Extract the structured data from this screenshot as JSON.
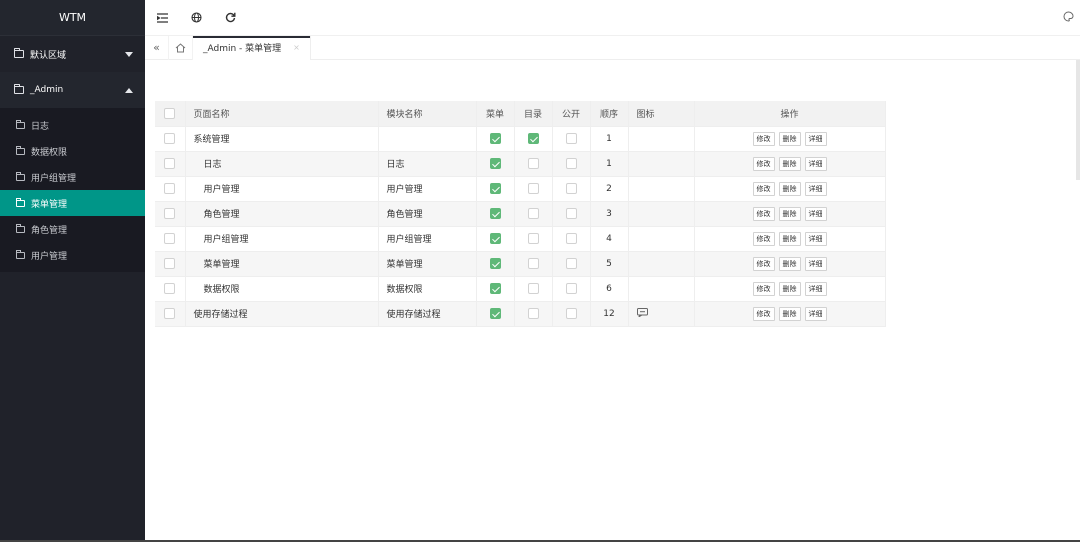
{
  "app": {
    "title": "WTM"
  },
  "sidebar": {
    "areas": [
      {
        "label": "默认区域",
        "open": false
      },
      {
        "label": "_Admin",
        "open": true
      }
    ],
    "items": [
      {
        "label": "日志"
      },
      {
        "label": "数据权限"
      },
      {
        "label": "用户组管理"
      },
      {
        "label": "菜单管理",
        "active": true
      },
      {
        "label": "角色管理"
      },
      {
        "label": "用户管理"
      }
    ]
  },
  "topbar": {
    "icons": [
      "menu-collapse-icon",
      "globe-icon",
      "refresh-icon",
      "theme-icon"
    ]
  },
  "tabs": {
    "items": [
      {
        "label": "_Admin - 菜单管理",
        "close": "×"
      }
    ]
  },
  "table": {
    "headers": {
      "name": "页面名称",
      "module": "模块名称",
      "menu": "菜单",
      "dir": "目录",
      "public": "公开",
      "order": "顺序",
      "icon": "图标",
      "ops": "操作"
    },
    "actions": {
      "edit": "修改",
      "delete": "删除",
      "detail": "详细"
    },
    "rows": [
      {
        "name": "系统管理",
        "module": "",
        "menu": true,
        "dir": true,
        "public": false,
        "order": "1",
        "icon": "",
        "indent": false
      },
      {
        "name": "日志",
        "module": "日志",
        "menu": true,
        "dir": false,
        "public": false,
        "order": "1",
        "icon": "",
        "indent": true
      },
      {
        "name": "用户管理",
        "module": "用户管理",
        "menu": true,
        "dir": false,
        "public": false,
        "order": "2",
        "icon": "",
        "indent": true
      },
      {
        "name": "角色管理",
        "module": "角色管理",
        "menu": true,
        "dir": false,
        "public": false,
        "order": "3",
        "icon": "",
        "indent": true
      },
      {
        "name": "用户组管理",
        "module": "用户组管理",
        "menu": true,
        "dir": false,
        "public": false,
        "order": "4",
        "icon": "",
        "indent": true
      },
      {
        "name": "菜单管理",
        "module": "菜单管理",
        "menu": true,
        "dir": false,
        "public": false,
        "order": "5",
        "icon": "",
        "indent": true
      },
      {
        "name": "数据权限",
        "module": "数据权限",
        "menu": true,
        "dir": false,
        "public": false,
        "order": "6",
        "icon": "",
        "indent": true
      },
      {
        "name": "使用存储过程",
        "module": "使用存储过程",
        "menu": true,
        "dir": false,
        "public": false,
        "order": "12",
        "icon": "message-icon",
        "indent": false
      }
    ]
  },
  "colors": {
    "sidebar": "#20222a",
    "active": "#009688",
    "check": "#5fb878"
  }
}
